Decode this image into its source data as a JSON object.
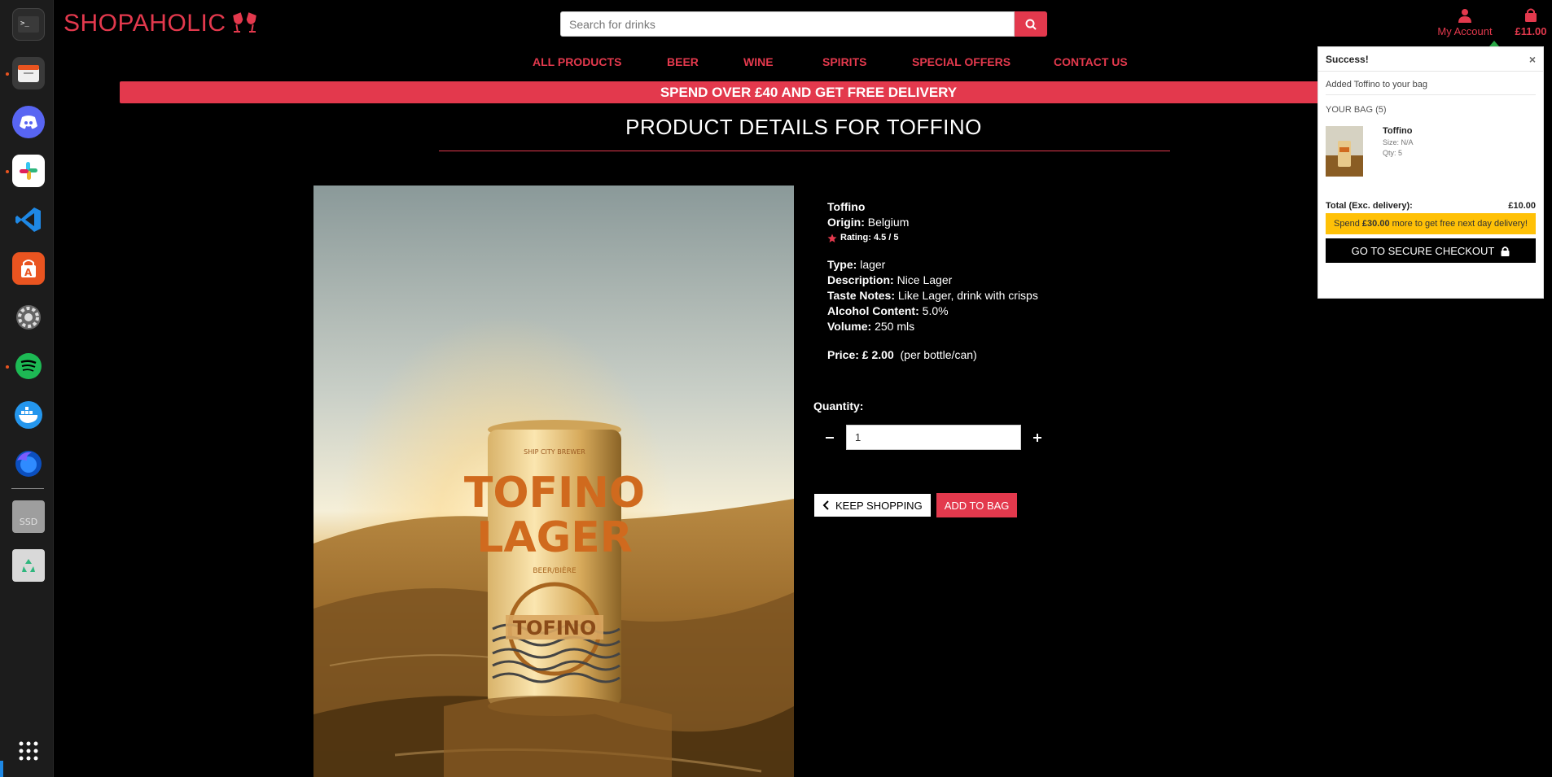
{
  "dock": {
    "items": [
      {
        "name": "terminal-icon",
        "color": "#2b2b2b"
      },
      {
        "name": "files-icon",
        "color": "#3a3a3a"
      },
      {
        "name": "discord-icon",
        "color": "#5865f2"
      },
      {
        "name": "slack-icon",
        "color": "#ffffff"
      },
      {
        "name": "vscode-icon",
        "color": "#1e88e5"
      },
      {
        "name": "app-center-icon",
        "color": "#e95420"
      },
      {
        "name": "settings-icon",
        "color": "#555555"
      },
      {
        "name": "spotify-icon",
        "color": "#1db954"
      },
      {
        "name": "docker-icon",
        "color": "#2496ed"
      },
      {
        "name": "firefox-icon",
        "color": "#0b4fbf"
      },
      {
        "name": "ssd-drive-icon",
        "color": "#9e9e9e"
      },
      {
        "name": "trash-icon",
        "color": "#d9d9d9"
      },
      {
        "name": "apps-grid-icon",
        "color": "#ffffff"
      }
    ],
    "ssd_label": "SSD"
  },
  "header": {
    "logo": "SHOPAHOLIC",
    "search_placeholder": "Search for drinks",
    "account_label": "My Account",
    "bag_total": "£11.00"
  },
  "nav": {
    "items": [
      "ALL PRODUCTS",
      "BEER",
      "WINE",
      "SPIRITS",
      "SPECIAL OFFERS",
      "CONTACT US"
    ]
  },
  "banner": "SPEND OVER £40 AND GET FREE DELIVERY",
  "page_title": "PRODUCT DETAILS FOR TOFFINO",
  "product": {
    "name": "Toffino",
    "origin_label": "Origin:",
    "origin": "Belgium",
    "rating_label": "Rating: 4.5 / 5",
    "type_label": "Type:",
    "type": "lager",
    "description_label": "Description:",
    "description": "Nice Lager",
    "taste_label": "Taste Notes:",
    "taste": "Like Lager, drink with crisps",
    "alcohol_label": "Alcohol Content:",
    "alcohol": "5.0%",
    "volume_label": "Volume:",
    "volume": "250 mls",
    "price_label": "Price: £ 2.00",
    "price_note": "(per bottle/can)",
    "can_text_top": "TOFINO",
    "can_text_bottom": "LAGER",
    "can_small": "BEER/BIÈRE",
    "can_badge": "TOFINO"
  },
  "quantity": {
    "label": "Quantity:",
    "value": "1"
  },
  "buttons": {
    "keep_shopping": "KEEP SHOPPING",
    "add_to_bag": "ADD TO BAG"
  },
  "colors": {
    "accent": "#e3394d",
    "success": "#28a745",
    "warning": "#ffc107"
  },
  "toast": {
    "title": "Success!",
    "close": "×",
    "message": "Added Toffino to your bag",
    "bag_heading": "YOUR BAG (5)",
    "item_name": "Toffino",
    "item_size": "Size: N/A",
    "item_qty": "Qty: 5",
    "total_label": "Total (Exc. delivery):",
    "total_value": "£10.00",
    "free_pre": "Spend",
    "free_amount": "£30.00",
    "free_post": "more to get free next day delivery!",
    "checkout": "GO TO SECURE CHECKOUT"
  }
}
